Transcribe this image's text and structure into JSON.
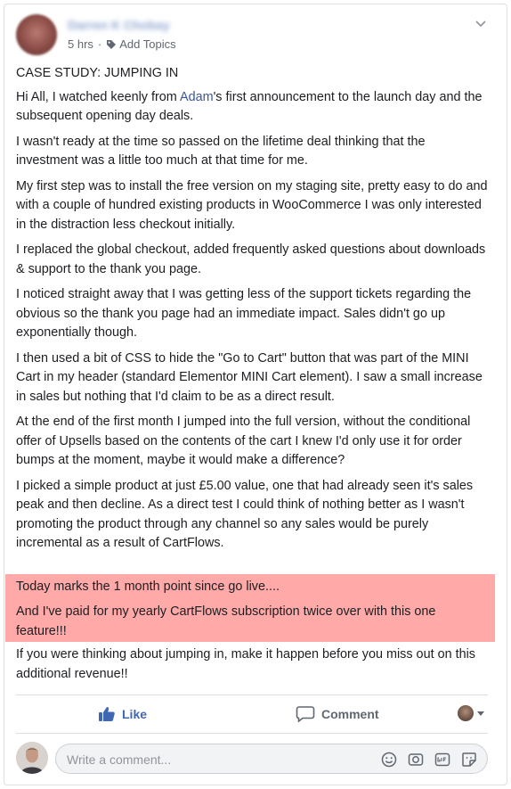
{
  "post": {
    "author_name": "Darren K Chobay",
    "time": "5 hrs",
    "separator": "·",
    "add_topics": "Add Topics",
    "title": "CASE STUDY: JUMPING IN",
    "p1_before": "Hi All, I watched keenly from ",
    "p1_link": "Adam",
    "p1_after": "'s first announcement to the launch day and the subsequent opening day deals.",
    "p2": "I wasn't ready at the time so passed on the lifetime deal thinking that the investment was a little too much at that time for me.",
    "p3": "My first step was to install the free version on my staging site, pretty easy to do and with a couple of hundred existing products in WooCommerce I was only interested in the distraction less checkout initially.",
    "p4": "I replaced the global checkout, added frequently asked questions about downloads & support to the thank you page.",
    "p5": "I noticed straight away that I was getting less of the support tickets regarding the obvious so the thank you page had an immediate impact. Sales didn't go up exponentially though.",
    "p6": "I then used a bit of CSS to hide the \"Go to Cart\" button that was part of the MINI Cart in my header (standard Elementor MINI Cart element). I saw a small increase in sales but nothing that I'd claim to be as a direct result.",
    "p7": "At the end of the first month I jumped into the full version, without the conditional offer of Upsells based on the contents of the cart I knew I'd only use it for order bumps at the moment, maybe it would make a difference?",
    "p8": "I picked a simple product at just £5.00 value, one that had already seen it's sales peak and then decline. As a direct test I could think of nothing better as I wasn't promoting the product through any channel so any sales would be purely incremental as a result of CartFlows.",
    "highlight1": "Today marks the 1 month point since go live....",
    "highlight2": "And I've paid for my yearly CartFlows subscription twice over with this one feature!!!",
    "p9": "If you were thinking about jumping in, make it happen before you miss out on this additional revenue!!",
    "highlight_color": "#ffa9a9"
  },
  "actions": {
    "like_label": "Like",
    "comment_label": "Comment",
    "like_color": "#4267b2"
  },
  "comment_input": {
    "placeholder": "Write a comment..."
  }
}
